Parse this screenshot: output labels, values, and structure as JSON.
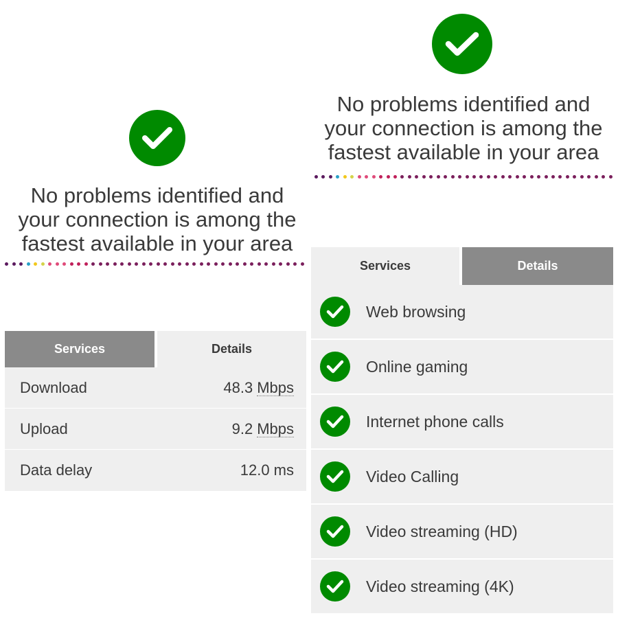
{
  "colors": {
    "success_green": "#008a00",
    "text": "#3a3a3a",
    "tab_active_bg": "#8a8a8a",
    "tab_active_text": "#ffffff",
    "tab_inactive_bg": "#efefef",
    "tab_inactive_text": "#3a3a3a",
    "row_bg": "#efefef",
    "dot_palette": [
      "#5b1a5e",
      "#2aa1c8",
      "#f2c81c",
      "#d4d44a",
      "#e04b7a",
      "#c0205a",
      "#7b1f5c"
    ]
  },
  "left_panel": {
    "status_icon": "check-circle-icon",
    "headline": {
      "line1": "No problems identified and",
      "line2": "your connection is among the",
      "line3": "fastest available in your area"
    },
    "tabs": {
      "services": "Services",
      "details": "Details",
      "active": "services"
    },
    "details_rows": [
      {
        "label": "Download",
        "value": "48.3",
        "unit": "Mbps"
      },
      {
        "label": "Upload",
        "value": "9.2",
        "unit": "Mbps"
      },
      {
        "label": "Data delay",
        "value": "12.0 ms",
        "unit": ""
      }
    ]
  },
  "right_panel": {
    "status_icon": "check-circle-icon",
    "headline": {
      "line1": "No problems identified and",
      "line2": "your connection is among the",
      "line3": "fastest available in your area"
    },
    "tabs": {
      "services": "Services",
      "details": "Details",
      "active": "details"
    },
    "services": [
      {
        "label": "Web browsing",
        "icon": "check-circle-icon"
      },
      {
        "label": "Online gaming",
        "icon": "check-circle-icon"
      },
      {
        "label": "Internet phone calls",
        "icon": "check-circle-icon"
      },
      {
        "label": "Video Calling",
        "icon": "check-circle-icon"
      },
      {
        "label": "Video streaming (HD)",
        "icon": "check-circle-icon"
      },
      {
        "label": "Video streaming (4K)",
        "icon": "check-circle-icon"
      }
    ]
  }
}
